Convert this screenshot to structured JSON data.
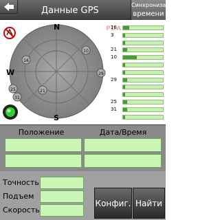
{
  "header": {
    "title": "Данные GPS",
    "sync_line1": "Синхронизация",
    "sync_line2": "времени"
  },
  "watermark": "PDA.RU",
  "compass": {
    "north": "N",
    "south": "S",
    "west": "W"
  },
  "sky_satellites": [
    "10",
    "16",
    "29",
    "21",
    "25",
    "31"
  ],
  "signals": [
    {
      "id": "16",
      "level": 0.15
    },
    {
      "id": "3",
      "level": 0.05
    },
    {
      "id": "",
      "level": 0.05
    },
    {
      "id": "21",
      "level": 0.1
    },
    {
      "id": "10",
      "level": 0.35
    },
    {
      "id": "",
      "level": 0.05
    },
    {
      "id": "",
      "level": 0.05
    },
    {
      "id": "29",
      "level": 0.1
    },
    {
      "id": "",
      "level": 0.05
    },
    {
      "id": "",
      "level": 0.05
    },
    {
      "id": "25",
      "level": 0.1
    },
    {
      "id": "31",
      "level": 0.1
    },
    {
      "id": "",
      "level": 0.05
    }
  ],
  "info": {
    "position_header": "Положение",
    "datetime_header": "Дата/Время"
  },
  "stats": {
    "accuracy_label": "Точность",
    "altitude_label": "Подъем",
    "speed_label": "Скорость"
  },
  "buttons": {
    "config": "Конфиг.",
    "find": "Найти"
  }
}
